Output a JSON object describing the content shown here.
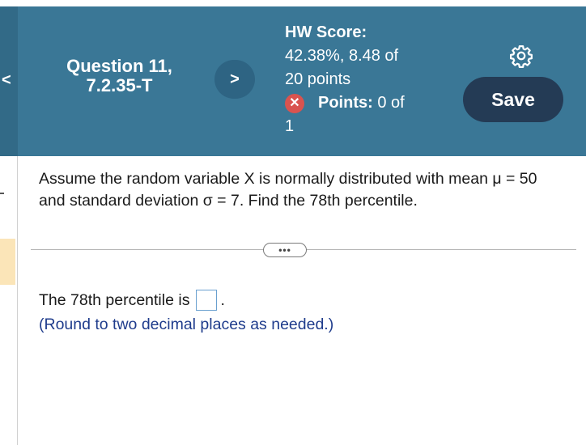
{
  "nav": {
    "prev_glyph": "<",
    "next_glyph": ">",
    "question_title": "Question 11,",
    "question_id": "7.2.35-T"
  },
  "score": {
    "title": "HW Score:",
    "line1": "42.38%, 8.48 of",
    "line2": "20 points",
    "points_label": "Points:",
    "points_value": "0 of",
    "points_total": "1",
    "status_icon": "x-circle-icon"
  },
  "actions": {
    "settings_icon": "gear-icon",
    "save_label": "Save"
  },
  "question": {
    "text": "Assume the random variable X is normally distributed with mean μ = 50 and standard deviation σ = 7. Find the 78th percentile.",
    "expand_glyph": "•••",
    "answer_prefix": "The 78th percentile is",
    "answer_value": "",
    "answer_suffix": ".",
    "hint": "(Round to two decimal places as needed.)"
  },
  "colors": {
    "header": "#3a7796",
    "save_button": "#243b55",
    "hint_text": "#1f3c8c"
  }
}
